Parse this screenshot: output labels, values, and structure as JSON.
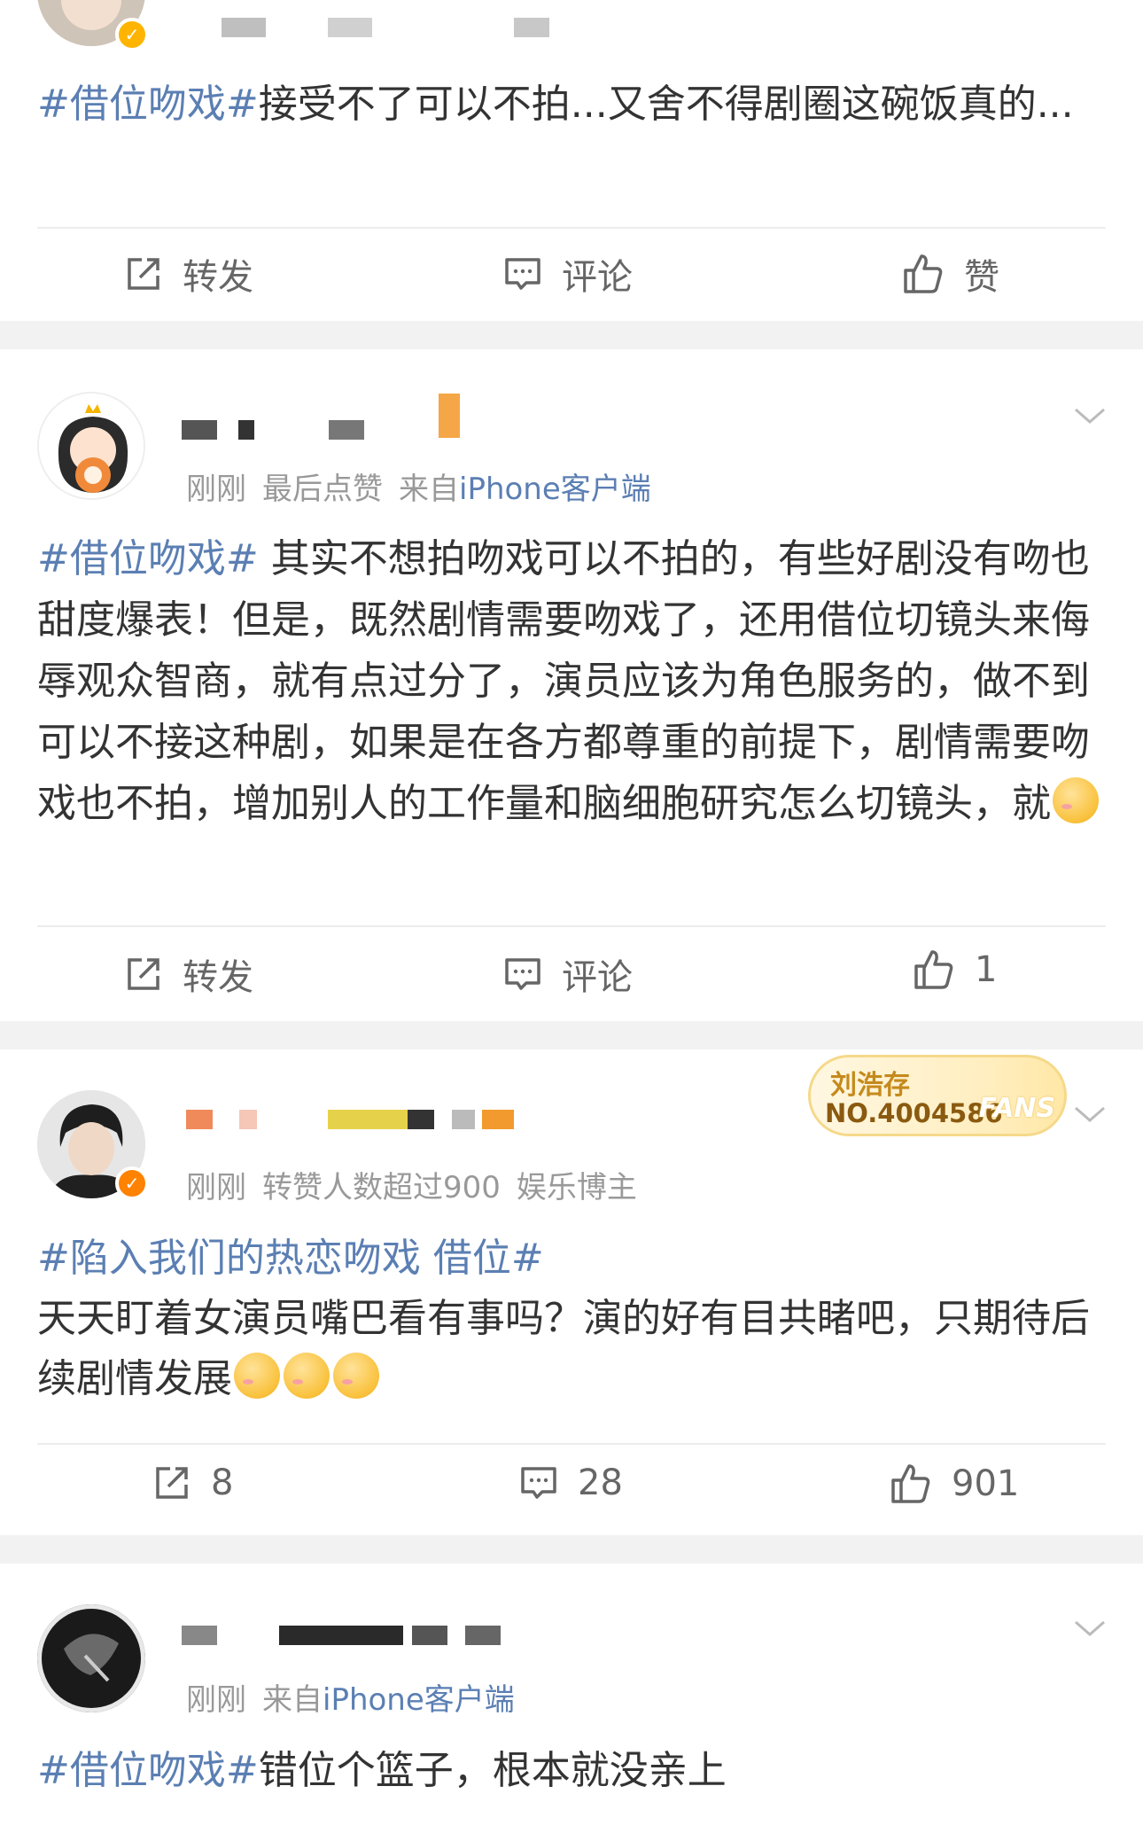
{
  "colors": {
    "accent": "#5b7fb3",
    "verified": "#ff8200",
    "background": "#f2f2f2"
  },
  "posts": [
    {
      "text_tag": "#借位吻戏#",
      "text_body": "接受不了可以不拍...又舍不得剧圈这碗饭真的...",
      "actions": {
        "repost": "转发",
        "comment": "评论",
        "like": "赞"
      }
    },
    {
      "meta_time": "刚刚",
      "meta_extra": "最后点赞",
      "meta_from": "来自",
      "meta_source": "iPhone客户端",
      "text_tag": "#借位吻戏#",
      "text_body": " 其实不想拍吻戏可以不拍的，有些好剧没有吻也甜度爆表！但是，既然剧情需要吻戏了，还用借位切镜头来侮辱观众智商，就有点过分了，演员应该为角色服务的，做不到可以不接这种剧，如果是在各方都尊重的前提下，剧情需要吻戏也不拍，增加别人的工作量和脑细胞研究怎么切镜头，就",
      "actions": {
        "repost": "转发",
        "comment": "评论",
        "like": "1"
      }
    },
    {
      "meta_time": "刚刚",
      "meta_extra": "转赞人数超过900",
      "meta_role": "娱乐博主",
      "fans_badge": {
        "name": "刘浩存",
        "number": "NO.4004586",
        "word": "FANS"
      },
      "text_tag": "#陷入我们的热恋吻戏 借位#",
      "text_body": "天天盯着女演员嘴巴看有事吗？演的好有目共睹吧，只期待后续剧情发展",
      "actions": {
        "repost": "8",
        "comment": "28",
        "like": "901"
      }
    },
    {
      "meta_time": "刚刚",
      "meta_from": "来自",
      "meta_source": "iPhone客户端",
      "text_tag": "#借位吻戏#",
      "text_body": "错位个篮子，根本就没亲上"
    }
  ]
}
